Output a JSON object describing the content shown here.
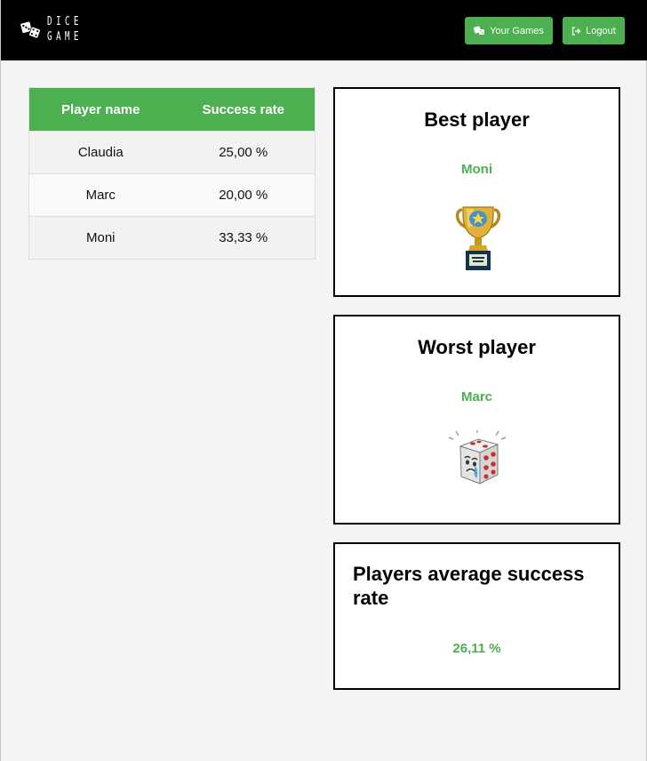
{
  "header": {
    "logo_line1": "DICE",
    "logo_line2": "GAME",
    "games_button_label": "Your Games",
    "logout_button_label": "Logout",
    "accent_color": "#4caf50"
  },
  "ranking_table": {
    "columns": [
      "Player name",
      "Success rate"
    ],
    "rows": [
      {
        "name": "Claudia",
        "rate": "25,00 %"
      },
      {
        "name": "Marc",
        "rate": "20,00 %"
      },
      {
        "name": "Moni",
        "rate": "33,33 %"
      }
    ]
  },
  "best_player": {
    "title": "Best player",
    "name": "Moni",
    "image": "trophy-icon"
  },
  "worst_player": {
    "title": "Worst player",
    "name": "Marc",
    "image": "crying-dice-icon"
  },
  "average": {
    "title": "Players average success rate",
    "value": "26,11 %"
  }
}
